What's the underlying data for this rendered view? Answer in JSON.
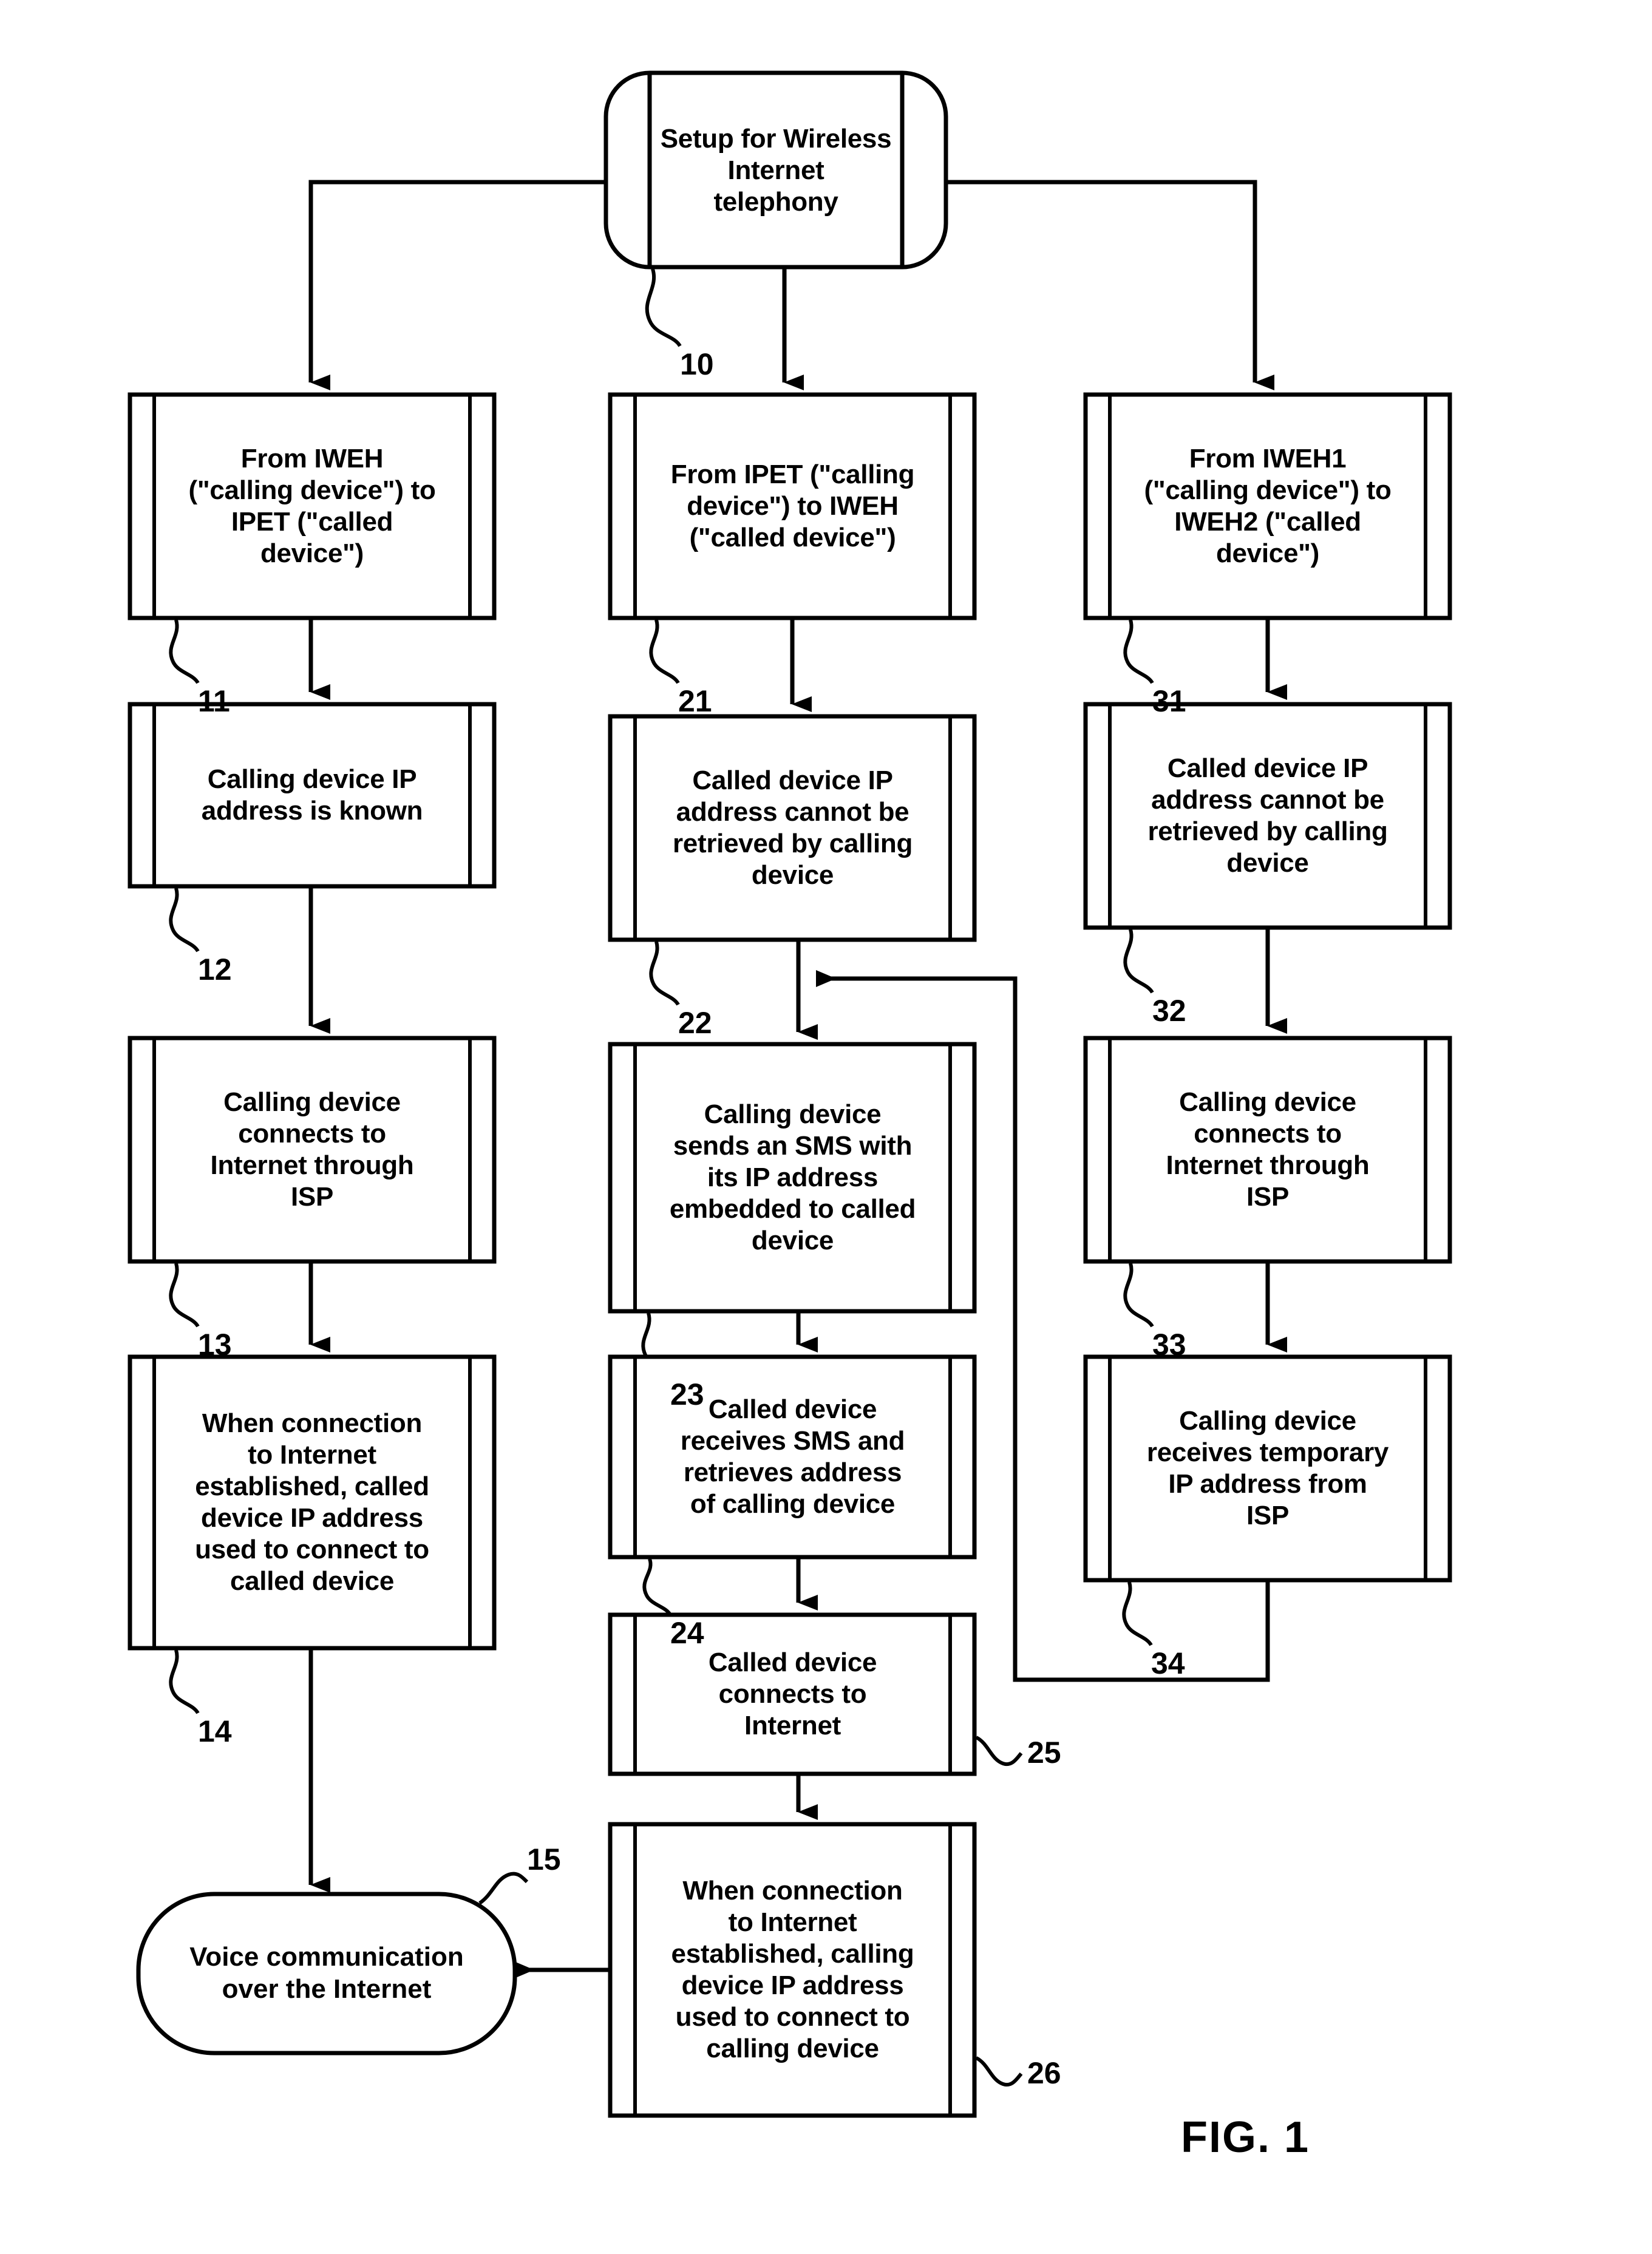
{
  "figure": {
    "caption": "FIG.   1",
    "type": "patent-flowchart",
    "title": "Setup for Wireless Internet telephony"
  },
  "nodes": {
    "start": {
      "ref": "10",
      "shape": "rounded-terminator",
      "text": "Setup for Wireless\nInternet\ntelephony"
    },
    "col1": [
      {
        "ref": "11",
        "shape": "process",
        "text": "From IWEH\n(\"calling device\") to\nIPET (\"called\ndevice\")"
      },
      {
        "ref": "12",
        "shape": "process",
        "text": "Calling device IP\naddress is known"
      },
      {
        "ref": "13",
        "shape": "process",
        "text": "Calling device\nconnects to\nInternet through\nISP"
      },
      {
        "ref": "14",
        "shape": "process",
        "text": "When connection\nto Internet\nestablished, called\ndevice IP address\nused to connect to\ncalled device"
      }
    ],
    "col2": [
      {
        "ref": "21",
        "shape": "process",
        "text": "From IPET (\"calling\ndevice\") to IWEH\n(\"called device\")"
      },
      {
        "ref": "22",
        "shape": "process",
        "text": "Called device IP\naddress cannot be\nretrieved by calling\ndevice"
      },
      {
        "ref": "23",
        "shape": "process",
        "text": "Calling device\nsends an SMS with\nits IP address\nembedded to called\ndevice"
      },
      {
        "ref": "24",
        "shape": "process",
        "text": "Called device\nreceives SMS and\nretrieves address\nof calling device"
      },
      {
        "ref": "25",
        "shape": "process",
        "text": "Called device\nconnects to\nInternet"
      },
      {
        "ref": "26",
        "shape": "process",
        "text": "When connection\nto Internet\nestablished, calling\ndevice IP address\nused to connect to\ncalling device"
      }
    ],
    "col3": [
      {
        "ref": "31",
        "shape": "process",
        "text": "From IWEH1\n(\"calling device\") to\nIWEH2 (\"called\ndevice\")"
      },
      {
        "ref": "32",
        "shape": "process",
        "text": "Called device IP\naddress cannot be\nretrieved by calling\ndevice"
      },
      {
        "ref": "33",
        "shape": "process",
        "text": "Calling device\nconnects to\nInternet through\nISP"
      },
      {
        "ref": "34",
        "shape": "process",
        "text": "Calling device\nreceives temporary\nIP address from\nISP"
      }
    ],
    "end": {
      "ref": "15",
      "shape": "rounded-terminator",
      "text": "Voice communication\nover the Internet"
    }
  },
  "colors": {
    "stroke": "#000000",
    "background": "#ffffff"
  }
}
